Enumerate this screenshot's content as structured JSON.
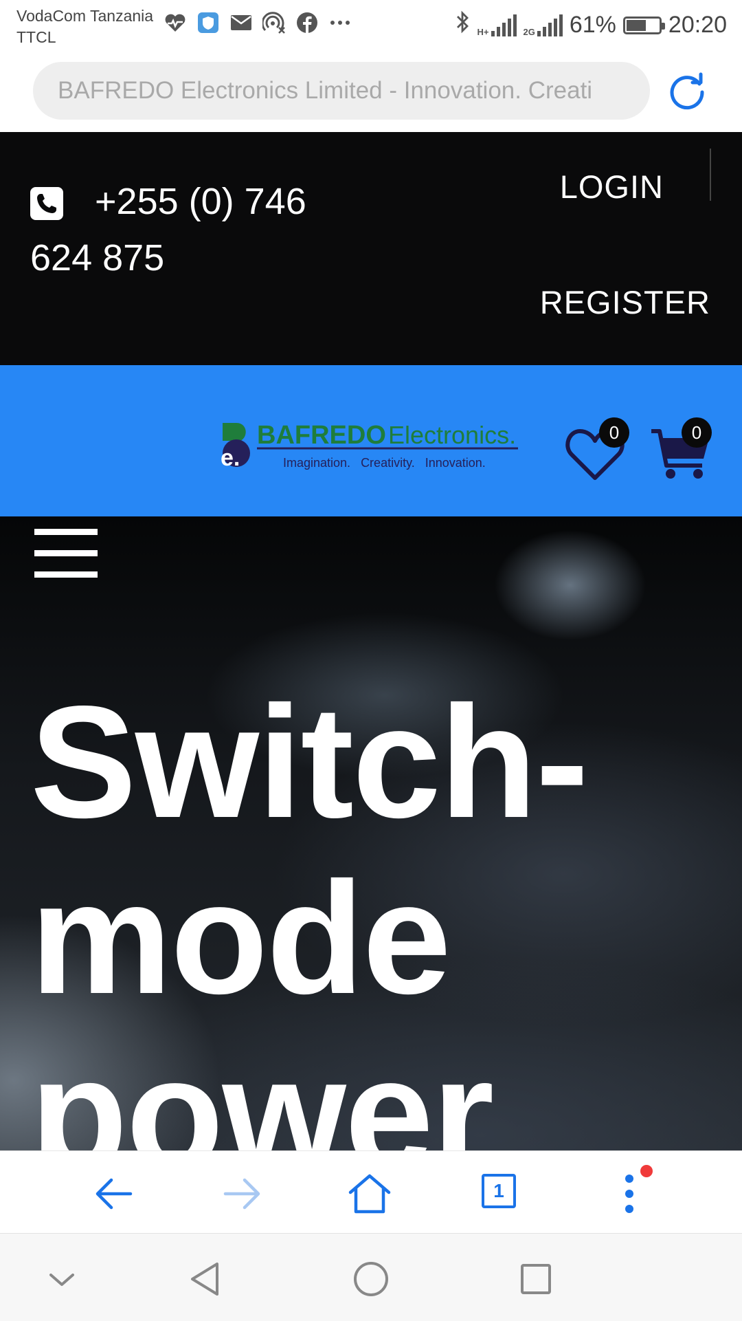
{
  "status_bar": {
    "carrier_line1": "VodaCom Tanzania",
    "carrier_line2": "TTCL",
    "notification_icons": [
      "heart-rate-icon",
      "shield-icon",
      "mail-icon",
      "hotspot-icon",
      "facebook-icon",
      "more-icon"
    ],
    "network_1": "H+",
    "network_2": "2G",
    "battery": "61%",
    "battery_level": 0.61,
    "time": "20:20"
  },
  "browser": {
    "url_text": "BAFREDO Electronics Limited - Innovation. Creati",
    "accent_color": "#1a73e8",
    "open_tabs": "1"
  },
  "top_bar": {
    "phone_line1": "+255 (0) 746",
    "phone_line2": "624 875",
    "login_label": "LOGIN",
    "register_label": "REGISTER"
  },
  "header": {
    "background_color": "#2787f5",
    "logo": {
      "brand_bold": "BAFREDO",
      "brand_light": "Electronics.",
      "tagline": "Imagination.   Creativity.   Innovation.",
      "mark_letter": "e."
    },
    "wishlist_count": "0",
    "cart_count": "0"
  },
  "hero": {
    "title": "Switch-mode power"
  }
}
